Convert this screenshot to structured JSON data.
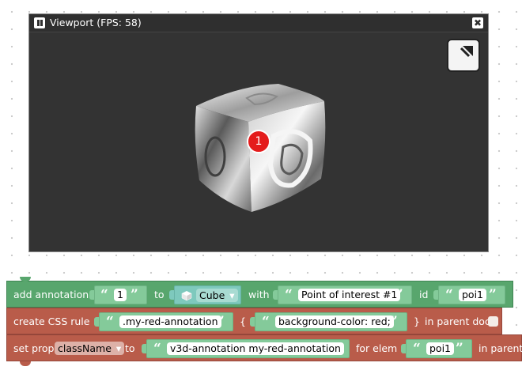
{
  "viewport": {
    "title": "Viewport (FPS: 58)",
    "pause_icon": "pause-icon",
    "close_icon": "close-icon",
    "close_glyph": "✖",
    "fullscreen_icon": "fullscreen-icon",
    "annotation_label": "1",
    "background_color": "#333333",
    "annotation_color": "#e41c1c"
  },
  "blocks": {
    "add_annotation": {
      "label": "add annotation",
      "name_value": "1",
      "to_label": "to",
      "object_icon": "cube-icon",
      "object_value": "Cube",
      "dropdown_arrow": "▾",
      "with_label": "with",
      "text_value": "Point of interest #1",
      "id_label": "id",
      "id_value": "poi1",
      "color": "#58a66d"
    },
    "create_css_rule": {
      "label": "create CSS rule",
      "selector_value": ".my-red-annotation",
      "open_brace": "{",
      "rule_value": "background-color: red;",
      "close_brace": "}",
      "in_parent_label": "in parent doc",
      "color": "#b95c4a"
    },
    "set_prop": {
      "label": "set prop",
      "prop_value": "className",
      "dropdown_arrow": "▾",
      "to_label": "to",
      "value": "v3d-annotation my-red-annotation",
      "for_elem_label": "for elem",
      "elem_value": "poi1",
      "in_parent_label": "in parent",
      "color": "#b95c4a"
    },
    "quote_open": "“",
    "quote_close": "”"
  }
}
